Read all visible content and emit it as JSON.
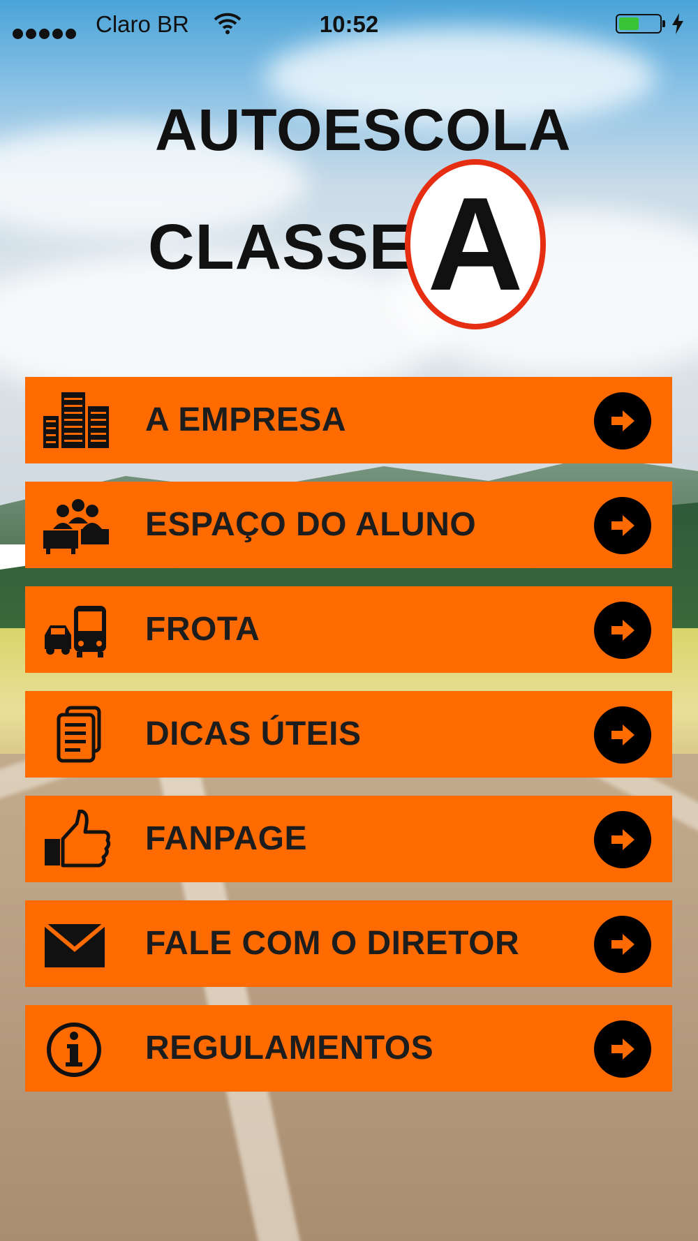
{
  "status_bar": {
    "carrier": "Claro BR",
    "time": "10:52",
    "signal_icon": "signal-dots-icon",
    "wifi_icon": "wifi-icon",
    "battery_icon": "battery-icon",
    "charging_icon": "bolt-icon",
    "battery_level": 0.5
  },
  "logo": {
    "line1": "AUTOESCOLA",
    "line2": "CLASSE",
    "badge_letter": "A",
    "badge_ring_color": "#e62e12"
  },
  "menu": {
    "button_color": "#ff6b00",
    "items": [
      {
        "label": "A EMPRESA",
        "icon": "buildings-icon"
      },
      {
        "label": "ESPAÇO DO ALUNO",
        "icon": "students-icon"
      },
      {
        "label": "FROTA",
        "icon": "car-bus-icon"
      },
      {
        "label": "DICAS ÚTEIS",
        "icon": "documents-icon"
      },
      {
        "label": "FANPAGE",
        "icon": "thumbs-up-icon"
      },
      {
        "label": "FALE COM O DIRETOR",
        "icon": "envelope-icon"
      },
      {
        "label": "REGULAMENTOS",
        "icon": "info-icon"
      }
    ],
    "arrow_icon": "arrow-right-icon"
  }
}
